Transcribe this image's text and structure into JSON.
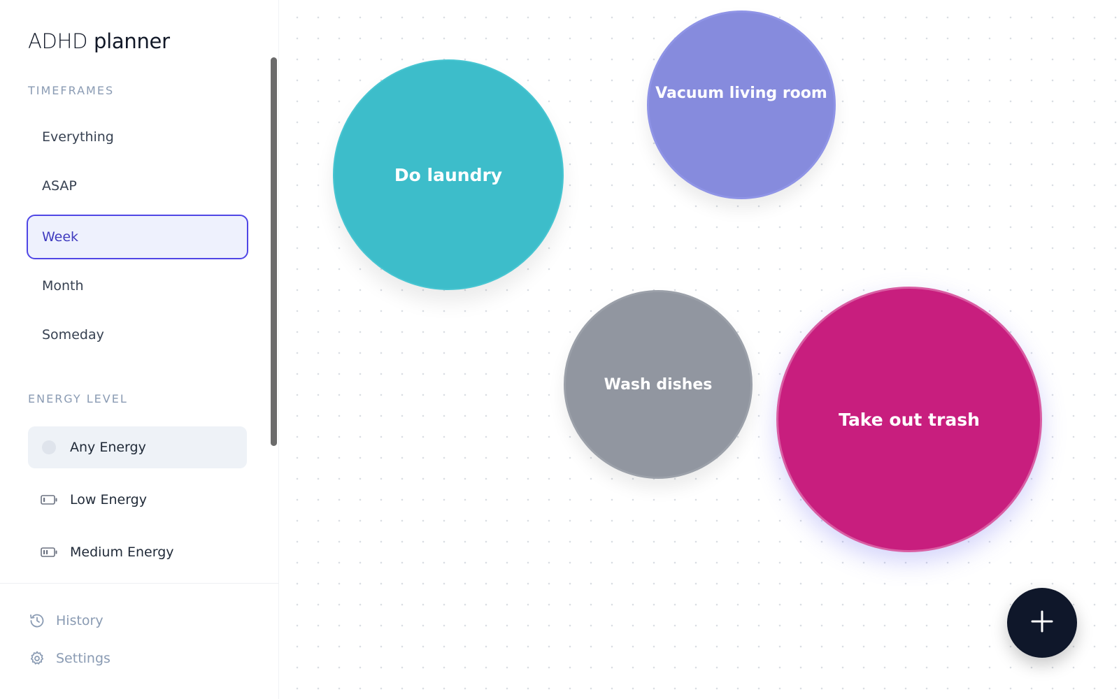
{
  "app": {
    "title_part1": "ADHD",
    "title_part2": "planner"
  },
  "sidebar": {
    "timeframes_label": "TIMEFRAMES",
    "timeframes": [
      {
        "label": "Everything",
        "active": false
      },
      {
        "label": "ASAP",
        "active": false
      },
      {
        "label": "Week",
        "active": true
      },
      {
        "label": "Month",
        "active": false
      },
      {
        "label": "Someday",
        "active": false
      }
    ],
    "energy_label": "ENERGY LEVEL",
    "energy_levels": [
      {
        "label": "Any Energy",
        "icon": "circle-dot-icon",
        "active": true
      },
      {
        "label": "Low Energy",
        "icon": "battery-low-icon",
        "active": false
      },
      {
        "label": "Medium Energy",
        "icon": "battery-medium-icon",
        "active": false
      }
    ],
    "footer": {
      "history_label": "History",
      "settings_label": "Settings"
    }
  },
  "tasks": [
    {
      "label": "Do laundry",
      "color": "#3dbdca"
    },
    {
      "label": "Vacuum living room",
      "color": "#868bdd"
    },
    {
      "label": "Wash dishes",
      "color": "#9196a0"
    },
    {
      "label": "Take out trash",
      "color": "#c81e7e"
    }
  ],
  "fab": {
    "icon": "plus-icon"
  },
  "colors": {
    "accent": "#4f46e5",
    "active_bg": "#eef1fd",
    "muted_text": "#8a9bb3",
    "fab_bg": "#0f172a"
  }
}
